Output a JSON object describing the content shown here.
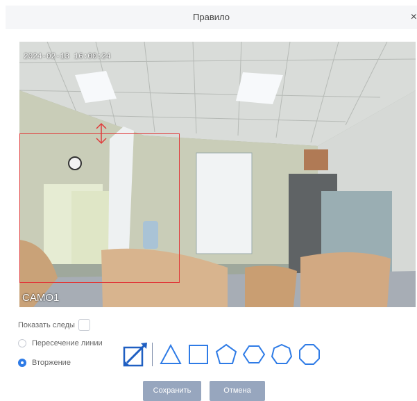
{
  "dialog": {
    "title": "Правило",
    "close_glyph": "×"
  },
  "video": {
    "timestamp": "2024-02-13 16:00:24",
    "camera_label": "CAMO1"
  },
  "options": {
    "show_traces_label": "Показать следы",
    "show_traces_checked": false,
    "line_crossing_label": "Пересечение линии",
    "intrusion_label": "Вторжение",
    "selected_mode": "intrusion"
  },
  "shapes": {
    "icons": [
      "resize-diagonal-icon",
      "triangle-icon",
      "square-icon",
      "pentagon-icon",
      "hexagon-icon",
      "heptagon-icon",
      "octagon-icon"
    ],
    "accent_color": "#2e7be6"
  },
  "buttons": {
    "save_label": "Сохранить",
    "cancel_label": "Отмена"
  },
  "colors": {
    "region_border": "#e03a3a",
    "button_bg": "#97a6be",
    "radio_active": "#2e7be6"
  }
}
